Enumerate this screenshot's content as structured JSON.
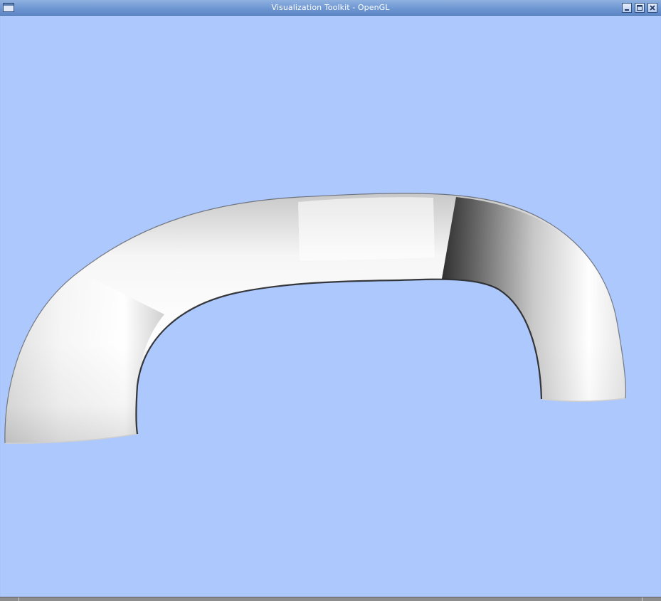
{
  "window": {
    "title": "Visualization Toolkit - OpenGL",
    "colors": {
      "background": "#adc8fc",
      "titlebar": "#6f97d2",
      "tube_light": "#ffffff",
      "tube_shadow": "#1a1a1a"
    }
  },
  "titlebar": {
    "system_menu_icon": "window-menu-icon",
    "minimize_icon": "minimize-icon",
    "maximize_icon": "maximize-icon",
    "close_icon": "close-icon"
  },
  "viewport": {
    "object": "tube-mesh"
  }
}
